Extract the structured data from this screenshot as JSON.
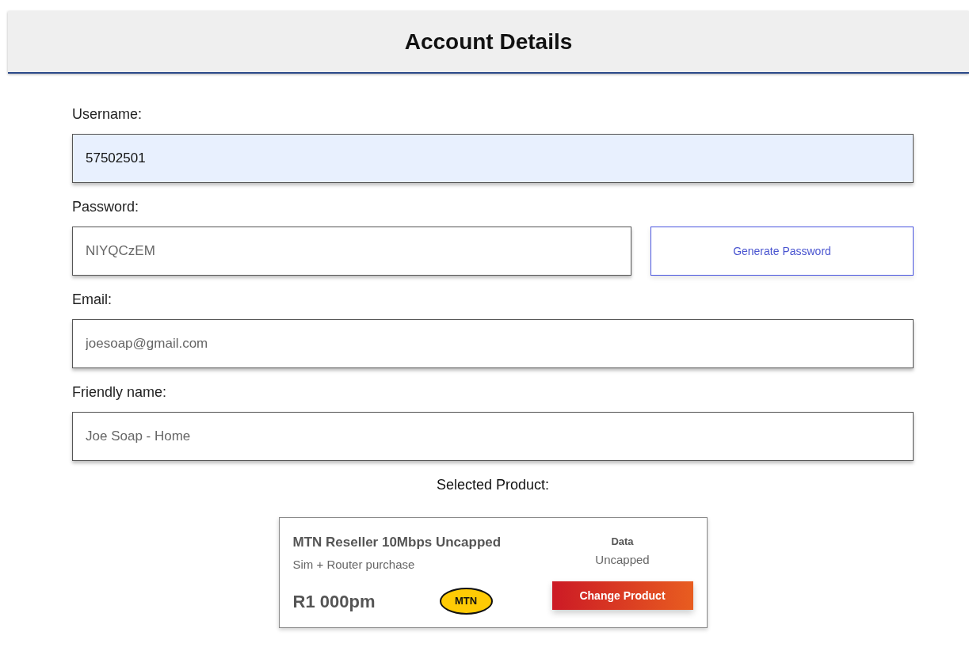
{
  "header": {
    "title": "Account Details"
  },
  "fields": [
    {
      "label": "Username:",
      "value": "57502501",
      "autofilled": true
    },
    {
      "label": "Password:",
      "value": "NIYQCzEM",
      "autofilled": false,
      "button": "Generate Password"
    },
    {
      "label": "Email:",
      "value": "joesoap@gmail.com",
      "autofilled": false
    },
    {
      "label": "Friendly name:",
      "value": "Joe Soap - Home",
      "autofilled": false
    }
  ],
  "product": {
    "heading": "Selected Product:",
    "name": "MTN Reseller 10Mbps Uncapped",
    "subtitle": "Sim + Router purchase",
    "price": "R1 000pm",
    "logo_text": "MTN",
    "data_label": "Data",
    "data_value": "Uncapped",
    "button": "Change Product"
  }
}
